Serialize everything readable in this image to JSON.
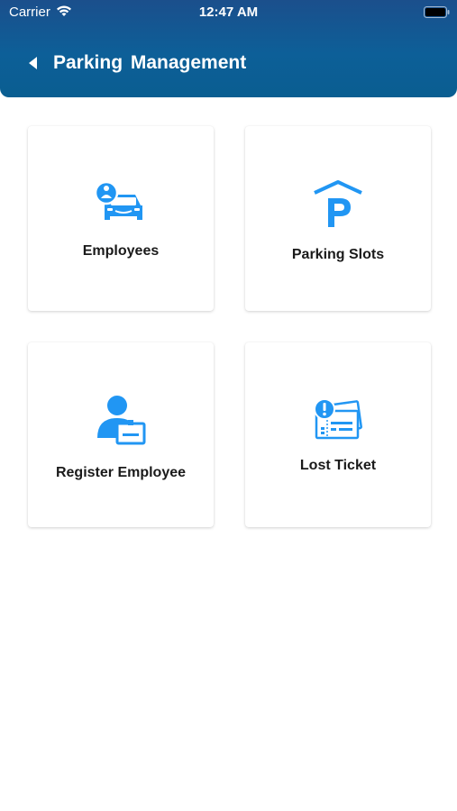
{
  "status_bar": {
    "carrier": "Carrier",
    "time": "12:47 AM"
  },
  "header": {
    "title": "Parking  Management"
  },
  "cards": [
    {
      "label": "Employees",
      "icon": "employee-car-icon"
    },
    {
      "label": "Parking Slots",
      "icon": "parking-icon"
    },
    {
      "label": "Register Employee",
      "icon": "register-employee-icon"
    },
    {
      "label": "Lost Ticket",
      "icon": "lost-ticket-icon"
    }
  ],
  "colors": {
    "header_top": "#1b4f8c",
    "header_bottom": "#0a5e91",
    "icon_blue": "#2196f3"
  }
}
